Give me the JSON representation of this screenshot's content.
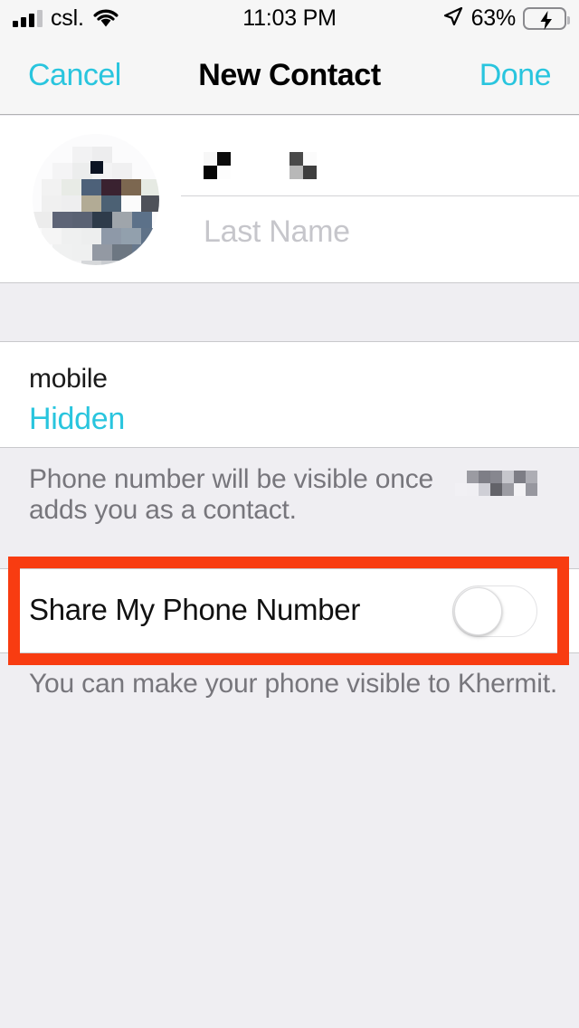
{
  "status_bar": {
    "carrier": "csl.",
    "time": "11:03 PM",
    "battery_percent": "63%",
    "signal_icon": "signal-bars-icon",
    "wifi_icon": "wifi-icon",
    "location_icon": "location-arrow-icon",
    "battery_icon": "battery-charging-icon",
    "battery_level": 63,
    "charging": true
  },
  "nav_bar": {
    "cancel_label": "Cancel",
    "title": "New Contact",
    "done_label": "Done",
    "accent_color": "#29c5de"
  },
  "name_section": {
    "avatar_name": "contact-photo",
    "first_name_value": "",
    "first_name_redacted": true,
    "last_name_placeholder": "Last Name",
    "last_name_value": ""
  },
  "phone_section": {
    "label": "mobile",
    "value": "Hidden",
    "value_color": "#29c5de"
  },
  "note_one": {
    "line1": "Phone number will be visible once",
    "line2": "adds you as a contact.",
    "redacted_name": true
  },
  "switch_row": {
    "label": "Share My Phone Number",
    "toggle_state": "off"
  },
  "note_two": {
    "text": "You can make your phone visible to Khermit."
  },
  "annotation": {
    "highlight_color": "#f83c11",
    "target": "share-my-phone-number-row"
  }
}
